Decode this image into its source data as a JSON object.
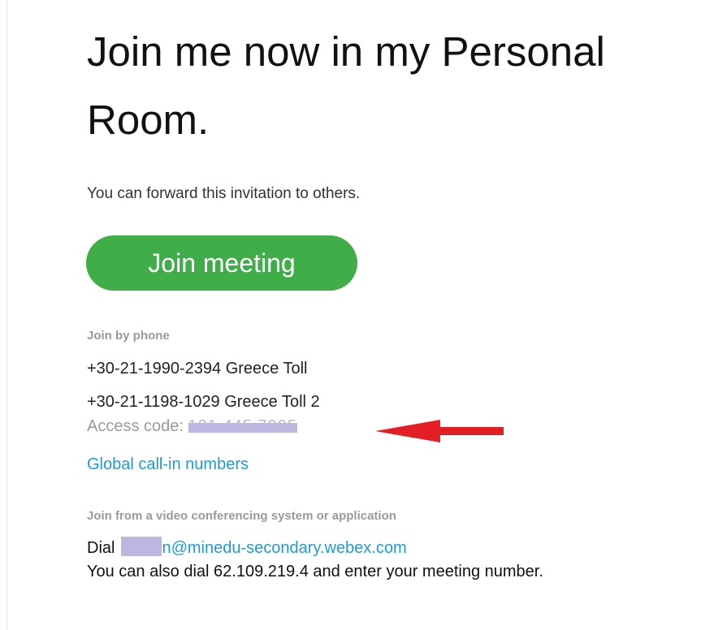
{
  "invitation": {
    "title": "Join me now in my Personal Room.",
    "forward_text": "You can forward this invitation to others.",
    "join_button_label": "Join meeting"
  },
  "phone": {
    "section_label": "Join by phone",
    "numbers": [
      "+30-21-1990-2394 Greece Toll",
      "+30-21-1198-1029 Greece Toll 2"
    ],
    "access_code_label": "Access code:",
    "access_code_value": "121 445 7005",
    "global_link_label": "Global call-in numbers"
  },
  "video": {
    "section_label": "Join from a video conferencing system or application",
    "dial_label": "Dial",
    "sip_address": "n@minedu-secondary.webex.com",
    "also_dial_text": "You can also dial 62.109.219.4 and enter your meeting number."
  },
  "colors": {
    "join_button": "#3fae49",
    "link": "#1e9bd7",
    "annotation_arrow": "#e31e24",
    "redaction": "#bdb6e0"
  },
  "icons": {
    "annotation": "red-arrow-icon"
  }
}
